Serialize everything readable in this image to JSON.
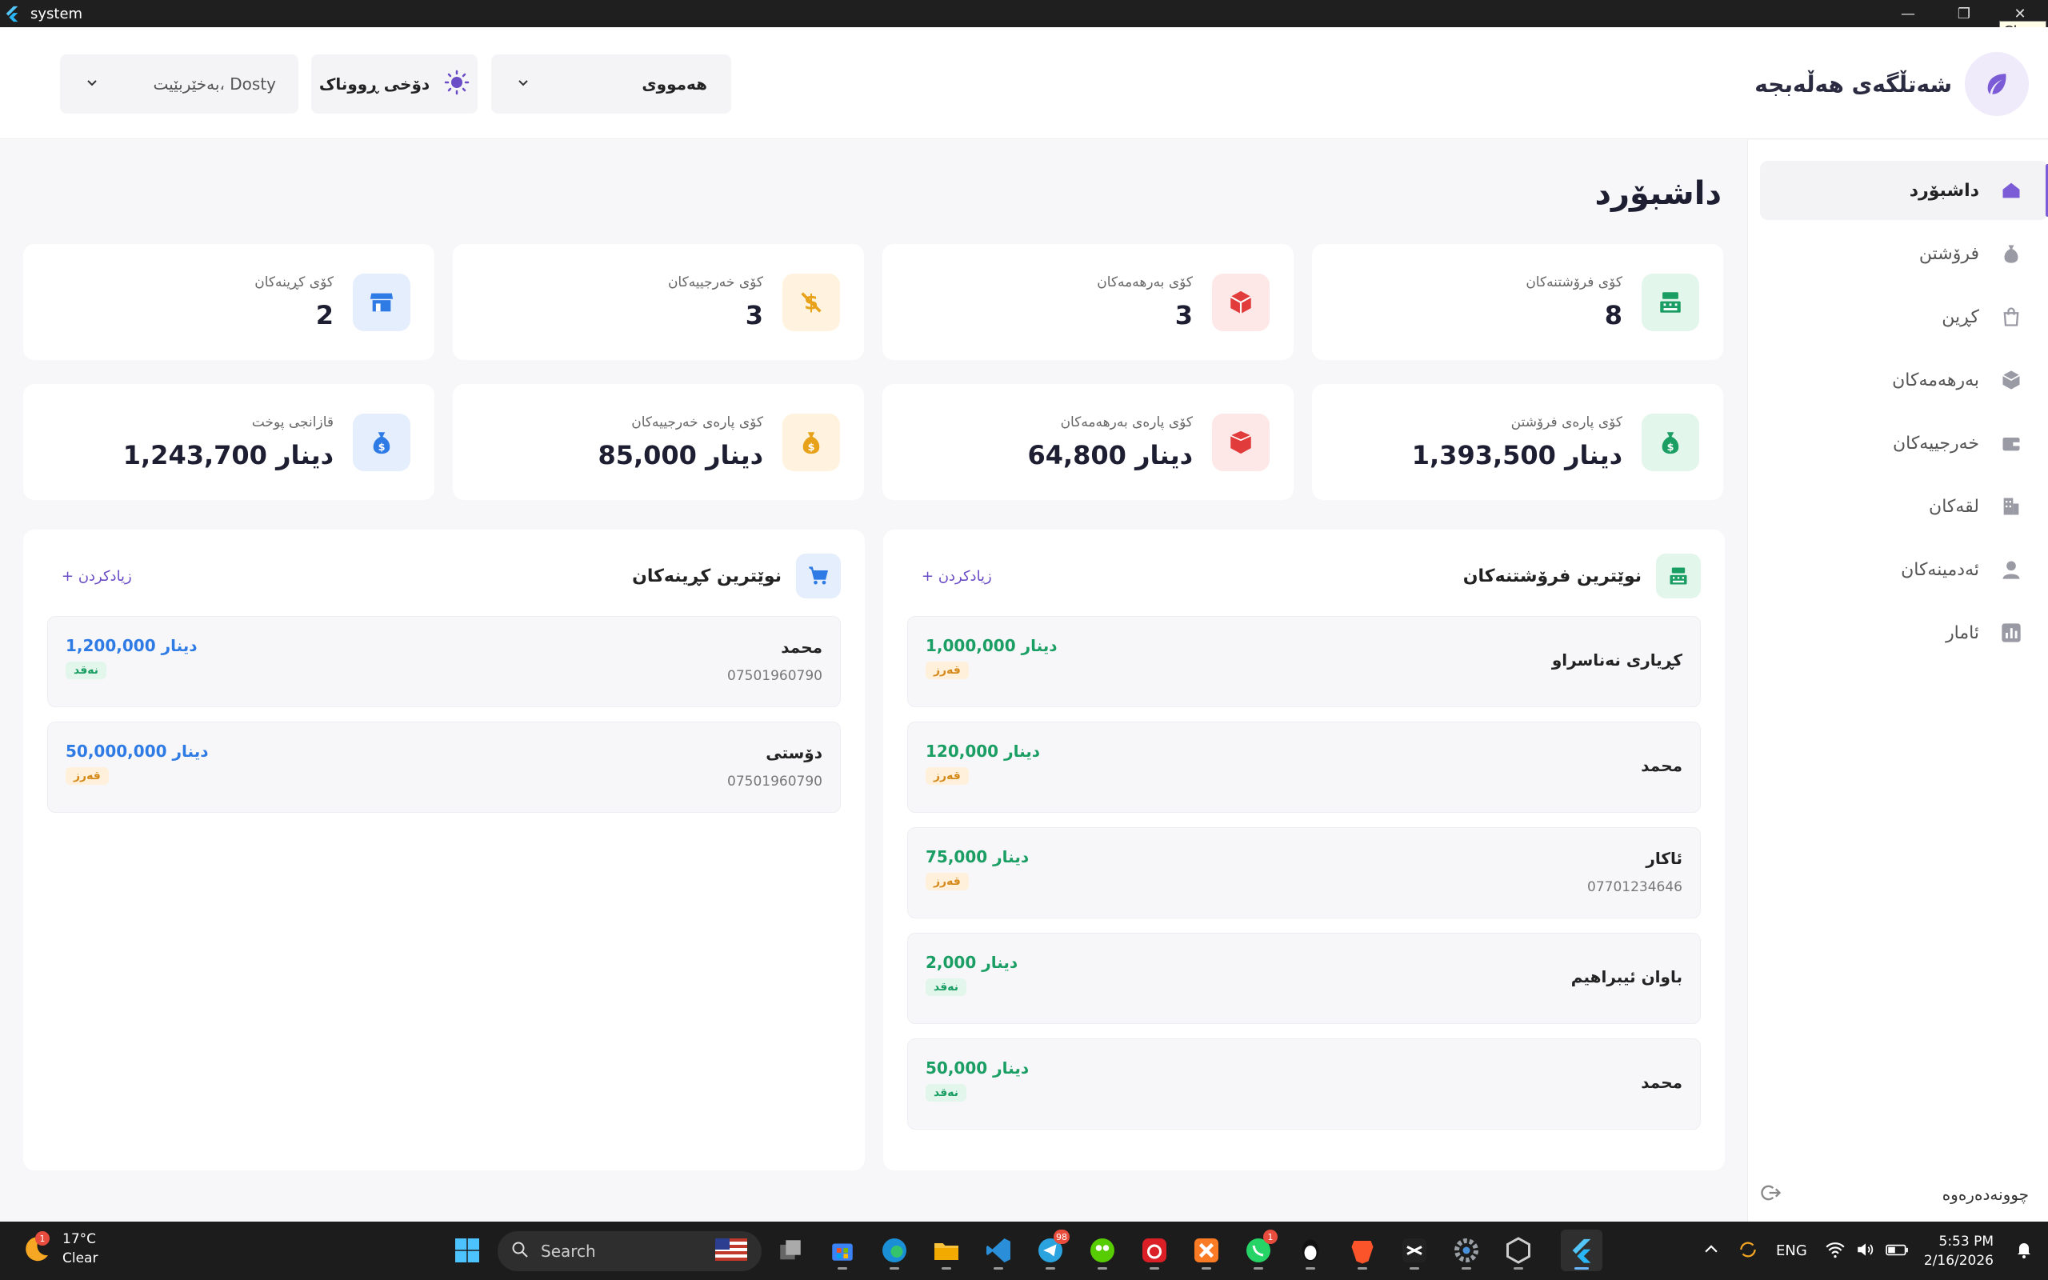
{
  "window": {
    "title": "system",
    "tooltip": "Close"
  },
  "brand": {
    "name": "شەتڵگەی هەڵەبجە"
  },
  "header": {
    "filter_value": "هەمووی",
    "theme_label": "دۆخی ڕووناک",
    "user_greeting": "بەخێربێیت، Dosty"
  },
  "sidebar": {
    "items": [
      {
        "label": "داشبۆرد",
        "icon": "home-icon",
        "active": true
      },
      {
        "label": "فرۆشتن",
        "icon": "money-bag-icon"
      },
      {
        "label": "کڕین",
        "icon": "shopping-bag-icon"
      },
      {
        "label": "بەرهەمەکان",
        "icon": "box-icon"
      },
      {
        "label": "خەرجییەکان",
        "icon": "wallet-icon"
      },
      {
        "label": "لقەکان",
        "icon": "building-icon"
      },
      {
        "label": "ئەدمینەکان",
        "icon": "user-icon"
      },
      {
        "label": "ئامار",
        "icon": "chart-icon"
      }
    ],
    "logout": "چوونەدەرەوە"
  },
  "page": {
    "title": "داشبۆرد"
  },
  "stats": [
    {
      "label": "کۆی فرۆشتنەکان",
      "value": "8",
      "icon": "cash-register-icon",
      "color": "#1a9e63"
    },
    {
      "label": "کۆی بەرهەمەکان",
      "value": "3",
      "icon": "box-icon",
      "color": "#e23b3b"
    },
    {
      "label": "کۆی خەرجییەکان",
      "value": "3",
      "icon": "dollar-slash-icon",
      "color": "#e7a21a"
    },
    {
      "label": "کۆی کڕینەکان",
      "value": "2",
      "icon": "store-icon",
      "color": "#2f7be5"
    },
    {
      "label": "کۆی پارەی فرۆشتن",
      "value": "1,393,500 دینار",
      "icon": "money-bag-icon",
      "color": "#1a9e63"
    },
    {
      "label": "کۆی پارەی بەرهەمەکان",
      "value": "64,800 دینار",
      "icon": "cube-icon",
      "color": "#e23b3b"
    },
    {
      "label": "کۆی پارەی خەرجییەکان",
      "value": "85,000 دینار",
      "icon": "money-bag-icon",
      "color": "#e7a21a"
    },
    {
      "label": "قازانجی پوخت",
      "value": "1,243,700 دینار",
      "icon": "money-bag-icon",
      "color": "#2f7be5"
    }
  ],
  "sales_panel": {
    "title": "نوێترین فرۆشتنەکان",
    "add_label": "+ زیادکردن",
    "rows": [
      {
        "name": "کڕیاری نەناسراو",
        "phone": "",
        "amount": "1,000,000 دینار",
        "badge": "قەرز",
        "badge_type": "debt"
      },
      {
        "name": "محمد",
        "phone": "",
        "amount": "120,000 دینار",
        "badge": "قەرز",
        "badge_type": "debt"
      },
      {
        "name": "ئاکار",
        "phone": "07701234646",
        "amount": "75,000 دینار",
        "badge": "قەرز",
        "badge_type": "debt"
      },
      {
        "name": "باوان ئیبراهیم",
        "phone": "",
        "amount": "2,000 دینار",
        "badge": "نەقد",
        "badge_type": "cash"
      },
      {
        "name": "محمد",
        "phone": "",
        "amount": "50,000 دینار",
        "badge": "نەقد",
        "badge_type": "cash"
      }
    ]
  },
  "purchases_panel": {
    "title": "نوێترین کڕینەکان",
    "add_label": "+ زیادکردن",
    "rows": [
      {
        "name": "محمد",
        "phone": "07501960790",
        "amount": "1,200,000 دینار",
        "badge": "نەقد",
        "badge_type": "cash"
      },
      {
        "name": "دۆستی",
        "phone": "07501960790",
        "amount": "50,000,000 دینار",
        "badge": "قەرز",
        "badge_type": "debt"
      }
    ]
  },
  "taskbar": {
    "weather_temp": "17°C",
    "weather_desc": "Clear",
    "weather_badge": "1",
    "search_placeholder": "Search",
    "telegram_badge": "98",
    "whatsapp_badge": "1",
    "lang": "ENG",
    "time": "5:53 PM",
    "date": "2/16/2026"
  },
  "colors": {
    "accent": "#7c5cd6",
    "sales_amount": "#1a9e63",
    "purchase_amount": "#2f7be5"
  }
}
